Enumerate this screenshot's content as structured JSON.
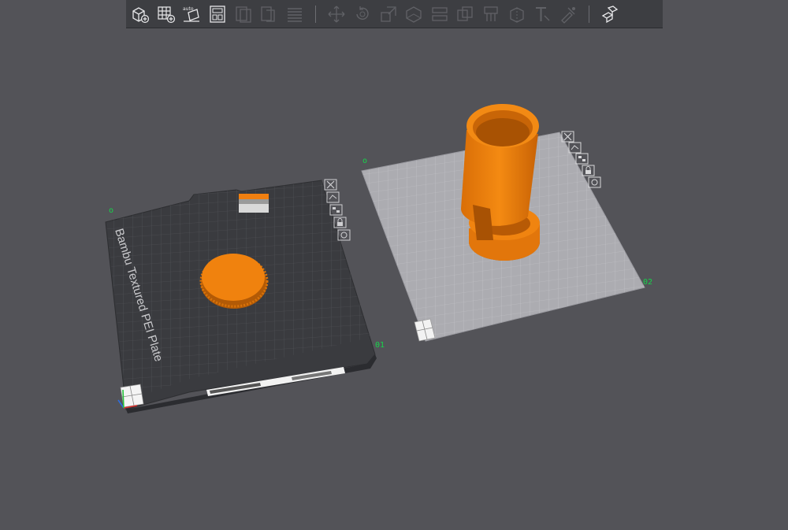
{
  "toolbar": {
    "groups": [
      {
        "name": "file",
        "items": [
          {
            "id": "add-object",
            "label": "Add",
            "icon": "cube-plus-icon",
            "enabled": true
          },
          {
            "id": "add-plate",
            "label": "Add plate",
            "icon": "grid-plus-icon",
            "enabled": true
          },
          {
            "id": "auto-orient",
            "label": "Auto orient",
            "icon": "auto-orient-icon",
            "enabled": true
          },
          {
            "id": "arrange",
            "label": "Arrange",
            "icon": "layout-icon",
            "enabled": true
          },
          {
            "id": "split-objects",
            "label": "Split to objects",
            "icon": "split-objects-icon",
            "enabled": false
          },
          {
            "id": "split-parts",
            "label": "Split to parts",
            "icon": "split-parts-icon",
            "enabled": false
          },
          {
            "id": "layers",
            "label": "Variable layer height",
            "icon": "layers-icon",
            "enabled": false
          }
        ]
      },
      {
        "name": "tools",
        "items": [
          {
            "id": "move",
            "label": "Move",
            "icon": "move-icon",
            "enabled": false
          },
          {
            "id": "rotate",
            "label": "Rotate",
            "icon": "rotate-icon",
            "enabled": false
          },
          {
            "id": "scale",
            "label": "Scale",
            "icon": "scale-icon",
            "enabled": false
          },
          {
            "id": "lay-on-face",
            "label": "Lay on face",
            "icon": "lay-on-face-icon",
            "enabled": false
          },
          {
            "id": "cut",
            "label": "Cut",
            "icon": "cut-icon",
            "enabled": false
          },
          {
            "id": "boolean",
            "label": "Mesh boolean",
            "icon": "boolean-icon",
            "enabled": false
          },
          {
            "id": "support-paint",
            "label": "Support painting",
            "icon": "support-paint-icon",
            "enabled": false
          },
          {
            "id": "seam-paint",
            "label": "Seam painting",
            "icon": "seam-paint-icon",
            "enabled": false
          },
          {
            "id": "text",
            "label": "Text shape",
            "icon": "text-icon",
            "enabled": false
          },
          {
            "id": "color-paint",
            "label": "Color painting",
            "icon": "color-paint-icon",
            "enabled": false
          }
        ]
      },
      {
        "name": "assembly",
        "items": [
          {
            "id": "assembly",
            "label": "Assembly view",
            "icon": "assembly-icon",
            "enabled": true
          }
        ]
      }
    ]
  },
  "plates": [
    {
      "name": "plate-01",
      "label": "01",
      "active": true,
      "bed_text": "Bambu Textured PEI Plate",
      "plate_color": "#3a3b3f"
    },
    {
      "name": "plate-02",
      "label": "02",
      "active": false,
      "plate_color": "#b4b4b8"
    }
  ],
  "plate_tools": [
    {
      "id": "remove",
      "icon": "close-icon"
    },
    {
      "id": "orient",
      "icon": "orient-icon"
    },
    {
      "id": "arrange",
      "icon": "arrange-icon"
    },
    {
      "id": "lock",
      "icon": "lock-icon"
    },
    {
      "id": "settings",
      "icon": "settings-icon"
    }
  ],
  "colors": {
    "background": "#535358",
    "model": "#f0820e",
    "accent_green": "#16d44a"
  }
}
